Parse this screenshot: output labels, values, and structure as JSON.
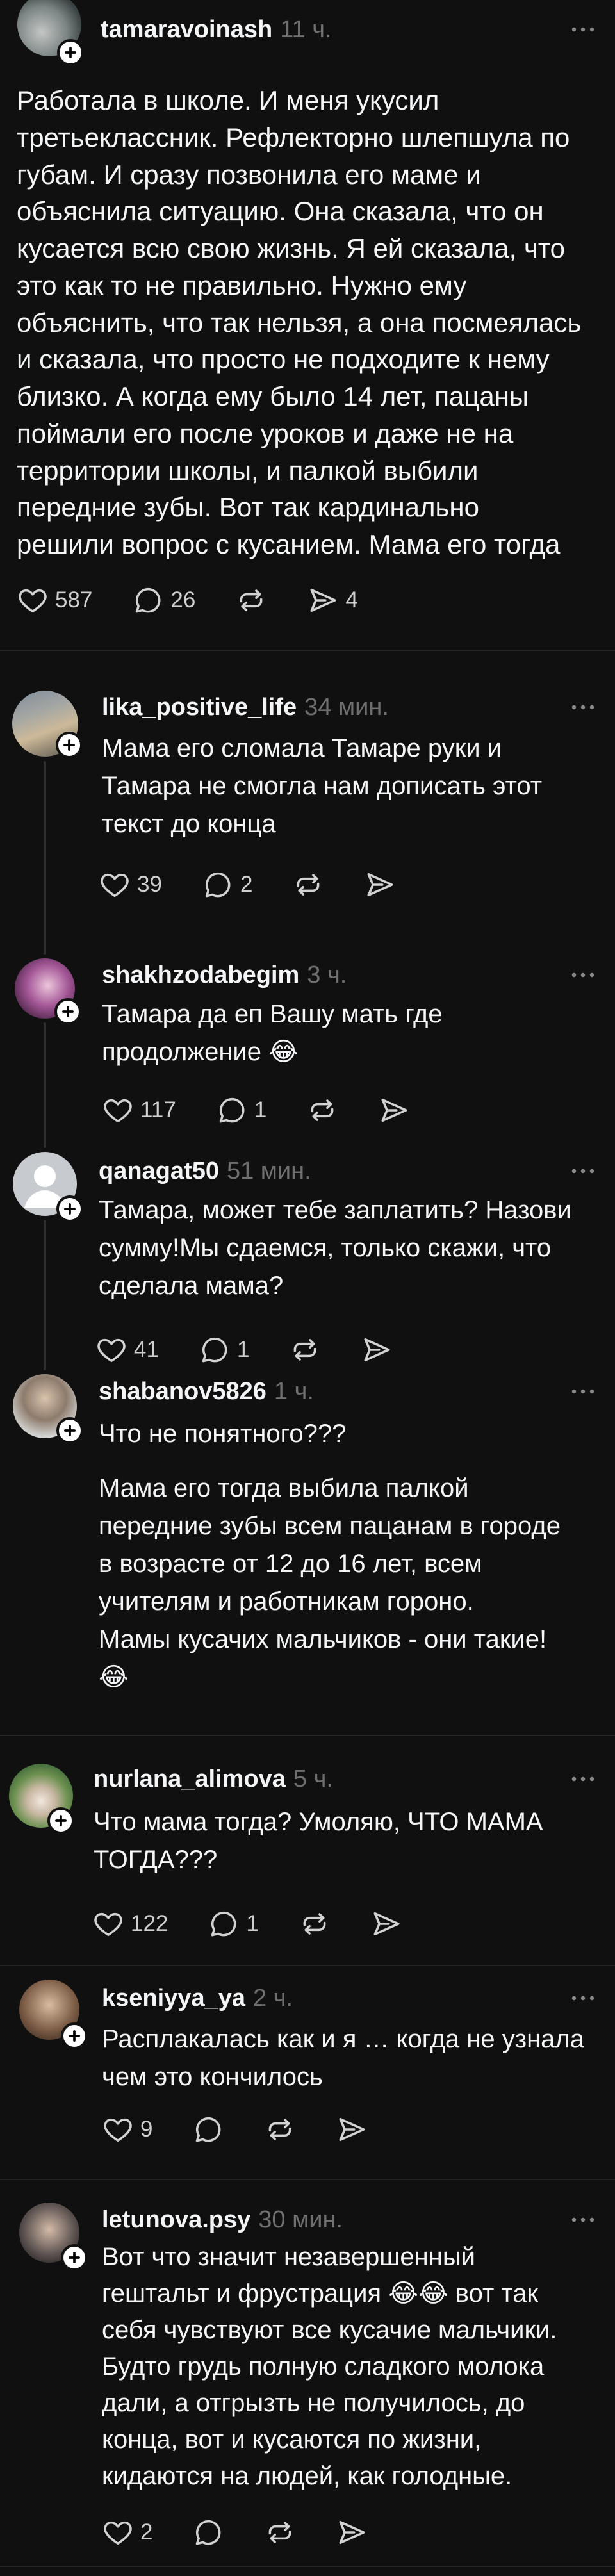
{
  "colors": {
    "background": "#101010",
    "text": "#f3f5f7",
    "muted": "#6f6f6f",
    "icon": "#d2d2d2",
    "divider": "#262626"
  },
  "icons": {
    "like": "heart-icon",
    "comment": "comment-icon",
    "repost": "repost-icon",
    "share": "share-icon",
    "more": "more-options-icon",
    "follow": "follow-plus-icon"
  },
  "posts": [
    {
      "username": "tamaravoinash",
      "time": "11 ч.",
      "lines": [
        "Работала в школе. И меня укусил",
        "третьеклассник. Рефлекторно шлепшула по",
        "губам. И сразу позвонила его маме и",
        "объяснила ситуацию. Она сказала, что он",
        "кусается всю свою жизнь. Я ей сказала, что",
        "это как то не правильно. Нужно ему",
        "объяснить, что так нельзя, а она посмеялась",
        "и сказала, что просто не подходите к нему",
        "близко. А когда ему было 14 лет, пацаны",
        "поймали его после уроков и даже не на",
        "территории школы, и палкой выбили",
        "передние зубы. Вот так кардинально",
        "решили вопрос с кусанием. Мама его тогда"
      ],
      "likes": "587",
      "comments": "26",
      "shares": "4"
    },
    {
      "username": "lika_positive_life",
      "time": "34 мин.",
      "lines": [
        "Мама его сломала Тамаре руки и",
        "Тамара не смогла нам дописать этот",
        "текст до конца"
      ],
      "likes": "39",
      "comments": "2"
    },
    {
      "username": "shakhzodabegim",
      "time": "3 ч.",
      "lines": [
        "Тамара да еп Вашу мать где",
        "продолжение 😂"
      ],
      "likes": "117",
      "comments": "1"
    },
    {
      "username": "qanagat50",
      "time": "51 мин.",
      "lines": [
        "Тамара, может тебе заплатить? Назови",
        "сумму!Мы сдаемся, только скажи, что",
        "сделала мама?"
      ],
      "likes": "41",
      "comments": "1"
    },
    {
      "username": "shabanov5826",
      "time": "1 ч.",
      "lines": [
        "Что не понятного???"
      ],
      "lines2": [
        "Мама его тогда выбила палкой",
        "передние зубы всем пацанам в городе",
        "в возрасте от 12 до 16 лет, всем",
        "учителям и работникам гороно.",
        "Мамы кусачих мальчиков - они такие!",
        "😂"
      ]
    },
    {
      "username": "nurlana_alimova",
      "time": "5 ч.",
      "lines": [
        "Что мама тогда? Умоляю, ЧТО МАМА",
        "ТОГДА???"
      ],
      "likes": "122",
      "comments": "1"
    },
    {
      "username": "kseniyya_ya",
      "time": "2 ч.",
      "lines": [
        "Расплакалась как и я … когда не узнала",
        "чем это кончилось"
      ],
      "likes": "9"
    },
    {
      "username": "letunova.psy",
      "time": "30 мин.",
      "lines": [
        "Вот что значит незавершенный",
        "гештальт и фрустрация 😂😂 вот так",
        "себя чувствуют все кусачие мальчики.",
        "Будто грудь полную сладкого молока",
        "дали, а отгрызть не получилось, до",
        "конца, вот и кусаются по жизни,",
        "кидаются на людей, как голодные."
      ],
      "likes": "2"
    }
  ]
}
